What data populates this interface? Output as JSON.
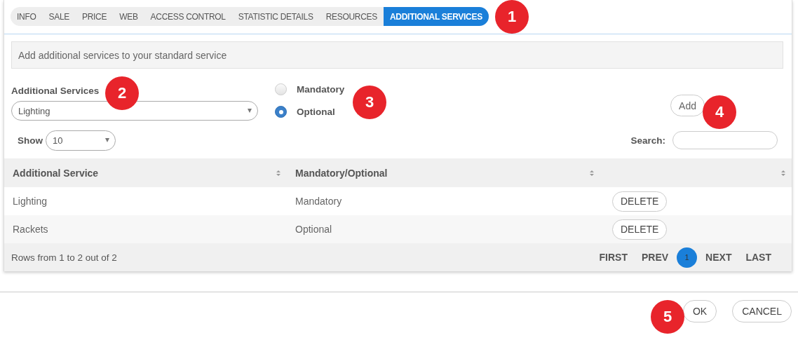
{
  "tabs": [
    {
      "label": "INFO",
      "selected": false
    },
    {
      "label": "SALE",
      "selected": false
    },
    {
      "label": "PRICE",
      "selected": false
    },
    {
      "label": "WEB",
      "selected": false
    },
    {
      "label": "ACCESS CONTROL",
      "selected": false
    },
    {
      "label": "STATISTIC DETAILS",
      "selected": false
    },
    {
      "label": "RESOURCES",
      "selected": false
    },
    {
      "label": "ADDITIONAL SERVICES",
      "selected": true
    }
  ],
  "info": "Add additional services to your standard service",
  "service_field": {
    "label": "Additional Services",
    "value": "Lighting"
  },
  "radios": [
    {
      "label": "Mandatory",
      "selected": false
    },
    {
      "label": "Optional",
      "selected": true
    }
  ],
  "add_button": "Add",
  "show": {
    "label": "Show",
    "value": "10"
  },
  "search": {
    "label": "Search:"
  },
  "table": {
    "columns": [
      "Additional Service",
      "Mandatory/Optional"
    ],
    "rows": [
      {
        "service": "Lighting",
        "type": "Mandatory",
        "action": "DELETE"
      },
      {
        "service": "Rackets",
        "type": "Optional",
        "action": "DELETE"
      }
    ],
    "footer": "Rows from 1 to 2 out of 2",
    "pager": [
      {
        "label": "FIRST",
        "kind": "link"
      },
      {
        "label": "PREV",
        "kind": "link"
      },
      {
        "label": "1",
        "kind": "page"
      },
      {
        "label": "NEXT",
        "kind": "link"
      },
      {
        "label": "LAST",
        "kind": "link"
      }
    ]
  },
  "buttons": [
    "OK",
    "CANCEL"
  ],
  "badges": [
    "1",
    "2",
    "3",
    "4",
    "5"
  ]
}
